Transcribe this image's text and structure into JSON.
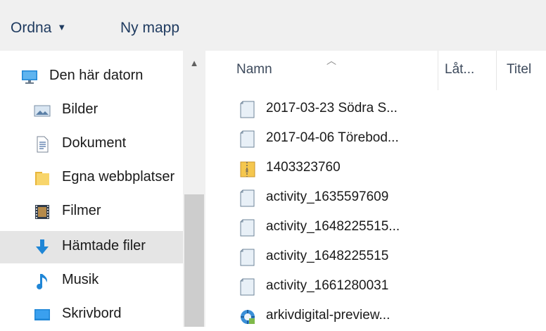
{
  "toolbar": {
    "organize": "Ordna",
    "new_folder": "Ny mapp"
  },
  "nav": {
    "items": [
      {
        "label": "Den här datorn",
        "icon": "computer-icon",
        "selected": false
      },
      {
        "label": "Bilder",
        "icon": "pictures-icon",
        "selected": false
      },
      {
        "label": "Dokument",
        "icon": "documents-icon",
        "selected": false
      },
      {
        "label": "Egna webbplatser",
        "icon": "folder-icon",
        "selected": false
      },
      {
        "label": "Filmer",
        "icon": "videos-icon",
        "selected": false
      },
      {
        "label": "Hämtade filer",
        "icon": "downloads-icon",
        "selected": true
      },
      {
        "label": "Musik",
        "icon": "music-icon",
        "selected": false
      },
      {
        "label": "Skrivbord",
        "icon": "desktop-icon",
        "selected": false
      }
    ]
  },
  "columns": {
    "name": "Namn",
    "lat": "Låt...",
    "title": "Titel"
  },
  "files": [
    {
      "name": "2017-03-23 Södra S...",
      "icon": "text-file-icon"
    },
    {
      "name": "2017-04-06 Törebod...",
      "icon": "text-file-icon"
    },
    {
      "name": "1403323760",
      "icon": "zip-folder-icon"
    },
    {
      "name": "activity_1635597609",
      "icon": "text-file-icon"
    },
    {
      "name": "activity_1648225515...",
      "icon": "text-file-icon"
    },
    {
      "name": "activity_1648225515",
      "icon": "text-file-icon"
    },
    {
      "name": "activity_1661280031",
      "icon": "text-file-icon"
    },
    {
      "name": "arkivdigital-preview...",
      "icon": "installer-icon"
    }
  ],
  "colors": {
    "selection": "#e5e5e5",
    "toolbar_bg": "#f0f0f0",
    "accent": "#0078d7"
  }
}
